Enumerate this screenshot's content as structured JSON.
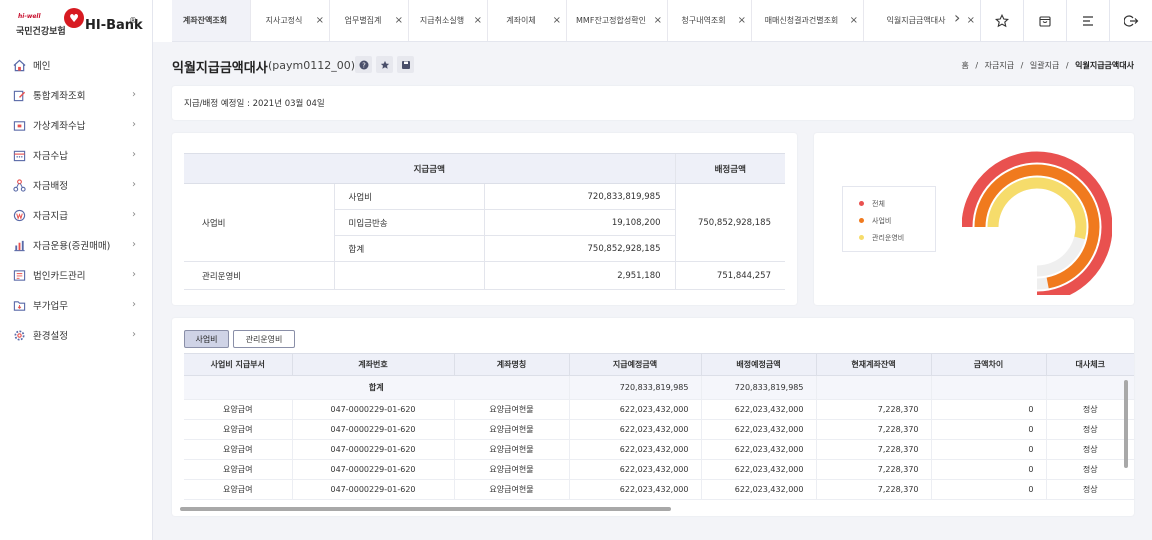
{
  "logo": {
    "tagline": "hi-well",
    "org": "국민건강보험",
    "brand": "HI-Bank",
    "reg": "®"
  },
  "menu": [
    {
      "label": "메인",
      "icon": "home-icon",
      "chevron": false
    },
    {
      "label": "통합계좌조회",
      "icon": "edit-icon",
      "chevron": true
    },
    {
      "label": "가상계좌수납",
      "icon": "wallet-icon",
      "chevron": true
    },
    {
      "label": "자금수납",
      "icon": "calendar-icon",
      "chevron": true
    },
    {
      "label": "자금배정",
      "icon": "network-icon",
      "chevron": true
    },
    {
      "label": "자금지급",
      "icon": "won-icon",
      "chevron": true
    },
    {
      "label": "자금운용(증권매매)",
      "icon": "bar-chart-icon",
      "chevron": true
    },
    {
      "label": "법인카드관리",
      "icon": "card-icon",
      "chevron": true
    },
    {
      "label": "부가업무",
      "icon": "folder-icon",
      "chevron": true
    },
    {
      "label": "환경설정",
      "icon": "gear-icon",
      "chevron": true
    }
  ],
  "tabs": [
    {
      "label": "계좌잔액조회",
      "close": ""
    },
    {
      "label": "지사고정식",
      "close": "×"
    },
    {
      "label": "업무별집계",
      "close": "×"
    },
    {
      "label": "지급취소실행",
      "close": "×"
    },
    {
      "label": "계좌이체",
      "close": "×"
    },
    {
      "label": "MMF잔고정합성확인",
      "close": "×"
    },
    {
      "label": "청구내역조회",
      "close": "×"
    },
    {
      "label": "매매신청결과건별조회",
      "close": "×"
    },
    {
      "label": "익월지급금액대사",
      "close": "×"
    }
  ],
  "page": {
    "title": "익월지급금액대사",
    "code": "(paym0112_00)"
  },
  "breadcrumb": {
    "home": "홈",
    "l1": "자금지급",
    "l2": "일괄지급",
    "current": "익월지급금액대사",
    "sep": "/"
  },
  "info": {
    "date_text": "지급/배정 예정일 : 2021년 03월 04일"
  },
  "summary": {
    "h_pay": "지급금액",
    "h_alloc": "배정금액",
    "group1": "사업비",
    "rows": [
      {
        "sub": "사업비",
        "pay": "720,833,819,985"
      },
      {
        "sub": "미입금반송",
        "pay": "19,108,200"
      },
      {
        "sub": "합계",
        "pay": "750,852,928,185"
      }
    ],
    "group1_alloc": "750,852,928,185",
    "group2": "관리운영비",
    "group2_pay": "2,951,180",
    "group2_alloc": "751,844,257"
  },
  "chart_data": {
    "type": "pie",
    "series": [
      {
        "name": "전체",
        "color": "#e9514f",
        "value": 1.0
      },
      {
        "name": "사업비",
        "color": "#f07a1e",
        "value": 0.96
      },
      {
        "name": "관리운영비",
        "color": "#f6dc6b",
        "value": 0.72
      }
    ],
    "legend": "left"
  },
  "detail": {
    "tab_active": "사업비",
    "tab_other": "관리운영비",
    "headers": [
      "사업비 지급부서",
      "계좌번호",
      "계좌명칭",
      "지급예정금액",
      "배정예정금액",
      "현재계좌잔액",
      "금액차이",
      "대사체크"
    ],
    "sum_label": "합계",
    "sum_pay": "720,833,819,985",
    "sum_alloc": "720,833,819,985",
    "rows": [
      [
        "요양급여",
        "047-0000229-01-620",
        "요양급여현물",
        "622,023,432,000",
        "622,023,432,000",
        "7,228,370",
        "0",
        "정상"
      ],
      [
        "요양급여",
        "047-0000229-01-620",
        "요양급여현물",
        "622,023,432,000",
        "622,023,432,000",
        "7,228,370",
        "0",
        "정상"
      ],
      [
        "요양급여",
        "047-0000229-01-620",
        "요양급여현물",
        "622,023,432,000",
        "622,023,432,000",
        "7,228,370",
        "0",
        "정상"
      ],
      [
        "요양급여",
        "047-0000229-01-620",
        "요양급여현물",
        "622,023,432,000",
        "622,023,432,000",
        "7,228,370",
        "0",
        "정상"
      ],
      [
        "요양급여",
        "047-0000229-01-620",
        "요양급여현물",
        "622,023,432,000",
        "622,023,432,000",
        "7,228,370",
        "0",
        "정상"
      ]
    ]
  }
}
